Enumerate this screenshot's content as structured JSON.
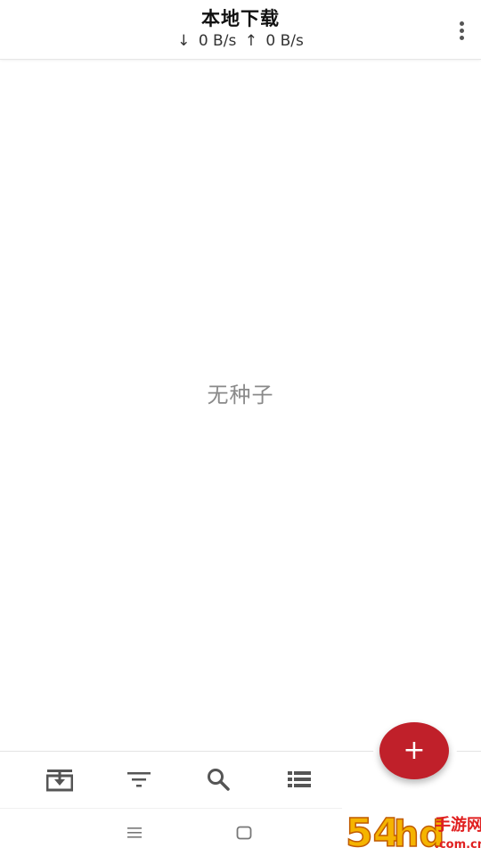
{
  "app_bar": {
    "title": "本地下载",
    "download_arrow": "↓",
    "download_speed": "0 B/s",
    "upload_arrow": "↑",
    "upload_speed": "0 B/s",
    "menu_icon": "more-vertical-icon"
  },
  "content": {
    "empty_message": "无种子"
  },
  "fab": {
    "label": "+",
    "color": "#c0202a"
  },
  "toolbar": {
    "items": [
      {
        "icon": "torrent-download-icon"
      },
      {
        "icon": "filter-icon"
      },
      {
        "icon": "search-icon"
      },
      {
        "icon": "list-icon"
      }
    ]
  },
  "system_nav": {
    "items": [
      {
        "icon": "menu-icon"
      },
      {
        "icon": "home-icon"
      },
      {
        "icon": "back-icon"
      }
    ]
  },
  "watermark": {
    "text": "54hd手游网 .com.cn",
    "colors": [
      "#f5b400",
      "#e02020"
    ]
  }
}
